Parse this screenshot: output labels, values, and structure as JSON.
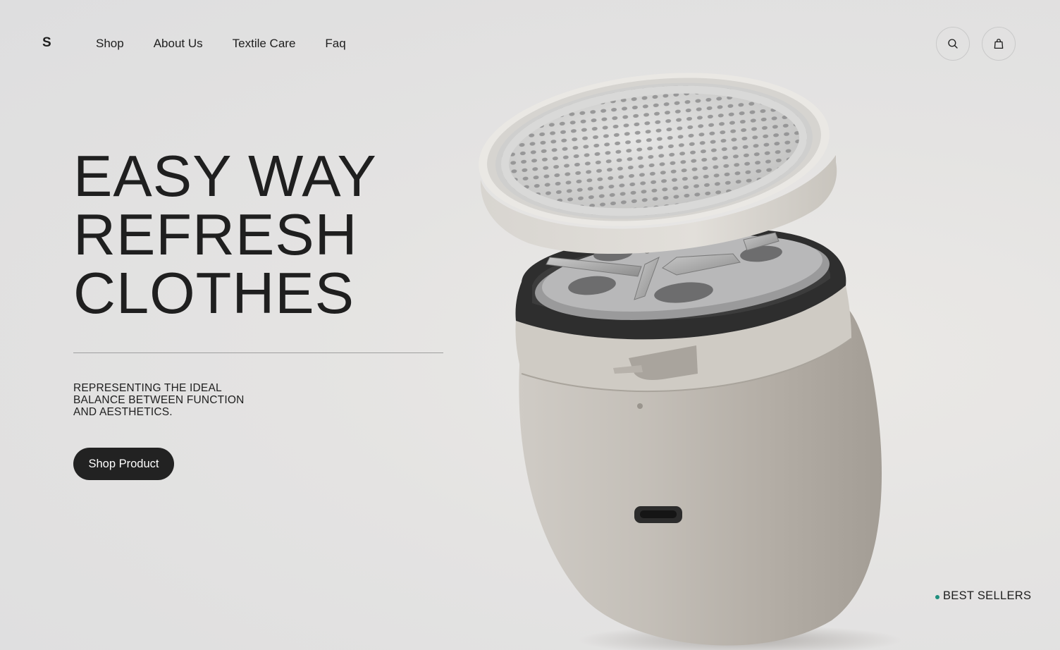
{
  "header": {
    "logo": "S",
    "nav": [
      "Shop",
      "About Us",
      "Textile Care",
      "Faq"
    ],
    "icons": {
      "search": "search-icon",
      "cart": "shopping-bag-icon"
    }
  },
  "hero": {
    "headline": [
      "EASY WAY",
      "REFRESH",
      "CLOTHES"
    ],
    "subtext": [
      "REPRESENTING THE IDEAL",
      "BALANCE BETWEEN FUNCTION",
      "AND AESTHETICS."
    ],
    "cta_label": "Shop Product"
  },
  "footer_link": {
    "label": "BEST SELLERS",
    "dot_color": "#1f8f7e"
  },
  "colors": {
    "background": "#e2e1e0",
    "text": "#1e1e1e",
    "button": "#222222",
    "accent": "#1f8f7e"
  }
}
